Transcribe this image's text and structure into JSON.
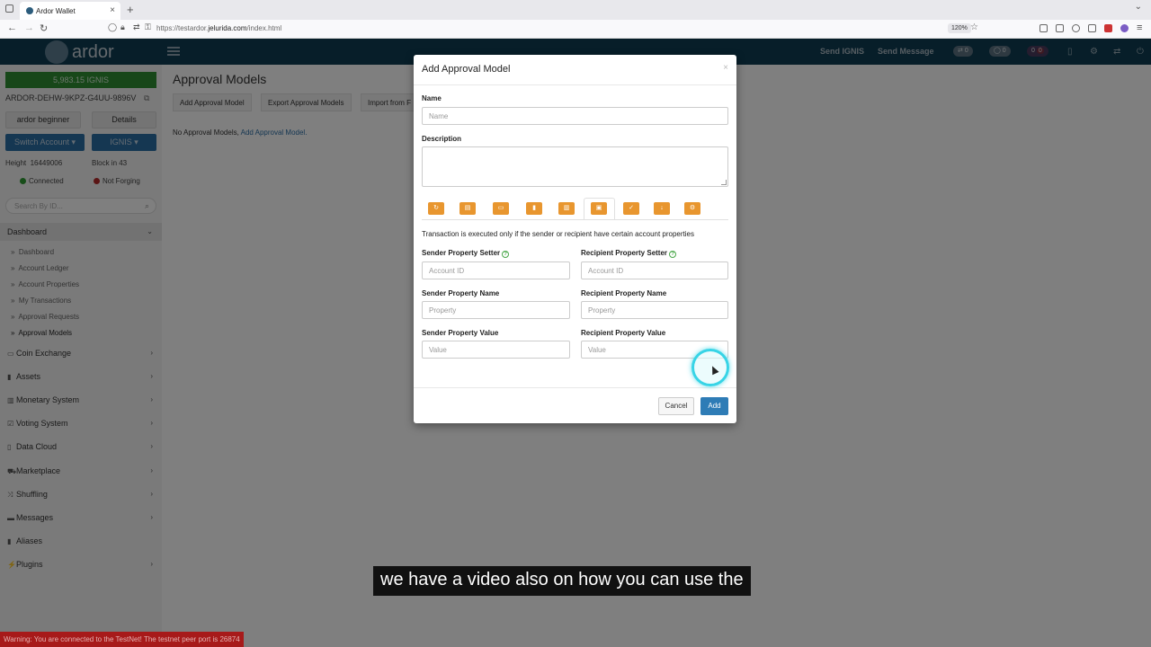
{
  "browser": {
    "tab_title": "Ardor Wallet",
    "url_prefix": "https://testardor.",
    "url_domain": "jelurida.com",
    "url_path": "/index.html",
    "zoom": "120%"
  },
  "app": {
    "logo_text": "ardor",
    "header_links": [
      "Send IGNIS",
      "Send Message"
    ],
    "pills": [
      "0",
      "0",
      "0",
      "0"
    ]
  },
  "sidebar": {
    "balance": "5,983.15 IGNIS",
    "account": "ARDOR-DEHW-9KPZ-G4UU-9896V",
    "account_name": "ardor beginner",
    "details": "Details",
    "switch_account": "Switch Account",
    "chain": "IGNIS",
    "height_label": "Height",
    "height_value": "16449006",
    "block_label": "Block in 43",
    "connected": "Connected",
    "forging": "Not Forging",
    "search_placeholder": "Search By ID...",
    "dashboard_section": "Dashboard",
    "sub_items": [
      "Dashboard",
      "Account Ledger",
      "Account Properties",
      "My Transactions",
      "Approval Requests",
      "Approval Models"
    ],
    "menu_items": [
      "Coin Exchange",
      "Assets",
      "Monetary System",
      "Voting System",
      "Data Cloud",
      "Marketplace",
      "Shuffling",
      "Messages",
      "Aliases",
      "Plugins"
    ]
  },
  "main": {
    "title": "Approval Models",
    "toolbar": [
      "Add Approval Model",
      "Export Approval Models",
      "Import from F"
    ],
    "empty_text": "No Approval Models,",
    "empty_link": "Add Approval Model."
  },
  "modal": {
    "title": "Add Approval Model",
    "close": "×",
    "name_label": "Name",
    "name_placeholder": "Name",
    "description_label": "Description",
    "tab_description": "Transaction is executed only if the sender or recipient have certain account properties",
    "sender_setter_label": "Sender Property Setter",
    "recipient_setter_label": "Recipient Property Setter",
    "account_placeholder": "Account ID",
    "sender_name_label": "Sender Property Name",
    "recipient_name_label": "Recipient Property Name",
    "property_placeholder": "Property",
    "sender_value_label": "Sender Property Value",
    "recipient_value_label": "Recipient Property Value",
    "value_placeholder": "Value",
    "cancel": "Cancel",
    "add": "Add"
  },
  "caption": "we have a video also on how you can use the",
  "warning": "Warning: You are connected to the TestNet! The testnet peer port is 26874"
}
